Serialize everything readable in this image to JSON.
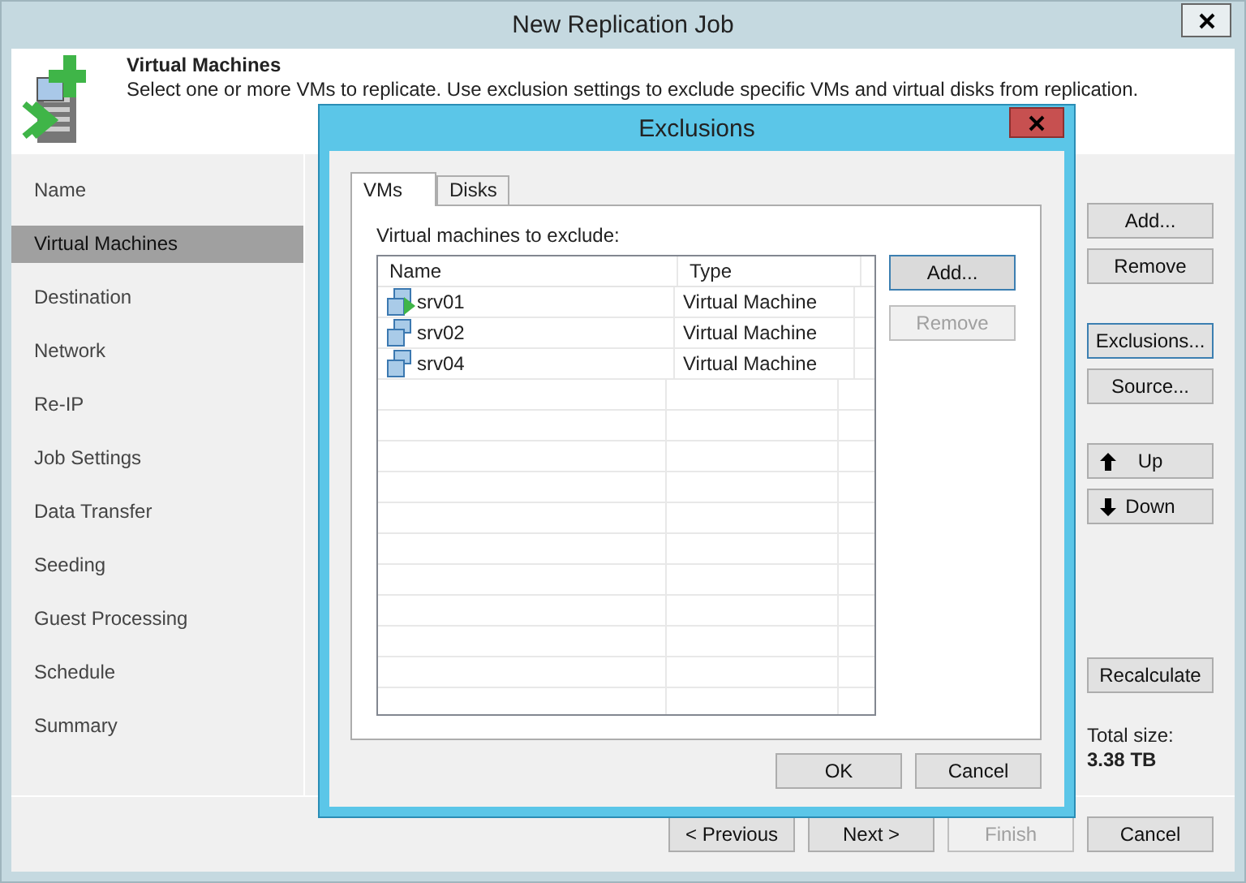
{
  "window": {
    "title": "New Replication Job"
  },
  "header": {
    "title": "Virtual Machines",
    "description": "Select one or more VMs to replicate. Use exclusion settings to exclude specific VMs and virtual disks from replication."
  },
  "steps": [
    {
      "label": "Name",
      "selected": false
    },
    {
      "label": "Virtual Machines",
      "selected": true
    },
    {
      "label": "Destination",
      "selected": false
    },
    {
      "label": "Network",
      "selected": false
    },
    {
      "label": "Re-IP",
      "selected": false
    },
    {
      "label": "Job Settings",
      "selected": false
    },
    {
      "label": "Data Transfer",
      "selected": false
    },
    {
      "label": "Seeding",
      "selected": false
    },
    {
      "label": "Guest Processing",
      "selected": false
    },
    {
      "label": "Schedule",
      "selected": false
    },
    {
      "label": "Summary",
      "selected": false
    }
  ],
  "side_buttons": [
    {
      "label": "Add...",
      "kind": "plain",
      "focused": false
    },
    {
      "label": "Remove",
      "kind": "plain",
      "focused": false
    },
    {
      "label": "Exclusions...",
      "kind": "plain",
      "focused": true
    },
    {
      "label": "Source...",
      "kind": "plain",
      "focused": false
    },
    {
      "label": "Up",
      "kind": "up",
      "focused": false
    },
    {
      "label": "Down",
      "kind": "down",
      "focused": false
    },
    {
      "label": "Recalculate",
      "kind": "plain",
      "focused": false
    }
  ],
  "total_size": {
    "label": "Total size:",
    "value": "3.38 TB"
  },
  "footer_buttons": [
    {
      "label": "< Previous",
      "disabled": false
    },
    {
      "label": "Next >",
      "disabled": false
    },
    {
      "label": "Finish",
      "disabled": true
    },
    {
      "label": "Cancel",
      "disabled": false
    }
  ],
  "dialog": {
    "title": "Exclusions",
    "tabs": [
      {
        "label": "VMs",
        "selected": true
      },
      {
        "label": "Disks",
        "selected": false
      }
    ],
    "list_label": "Virtual machines to exclude:",
    "columns": [
      "Name",
      "Type"
    ],
    "rows": [
      {
        "name": "srv01",
        "type": "Virtual Machine",
        "running": true
      },
      {
        "name": "srv02",
        "type": "Virtual Machine",
        "running": false
      },
      {
        "name": "srv04",
        "type": "Virtual Machine",
        "running": false
      }
    ],
    "buttons": [
      {
        "label": "Add...",
        "disabled": false,
        "focused": true
      },
      {
        "label": "Remove",
        "disabled": true,
        "focused": false
      }
    ],
    "footer_buttons": [
      "OK",
      "Cancel"
    ]
  }
}
